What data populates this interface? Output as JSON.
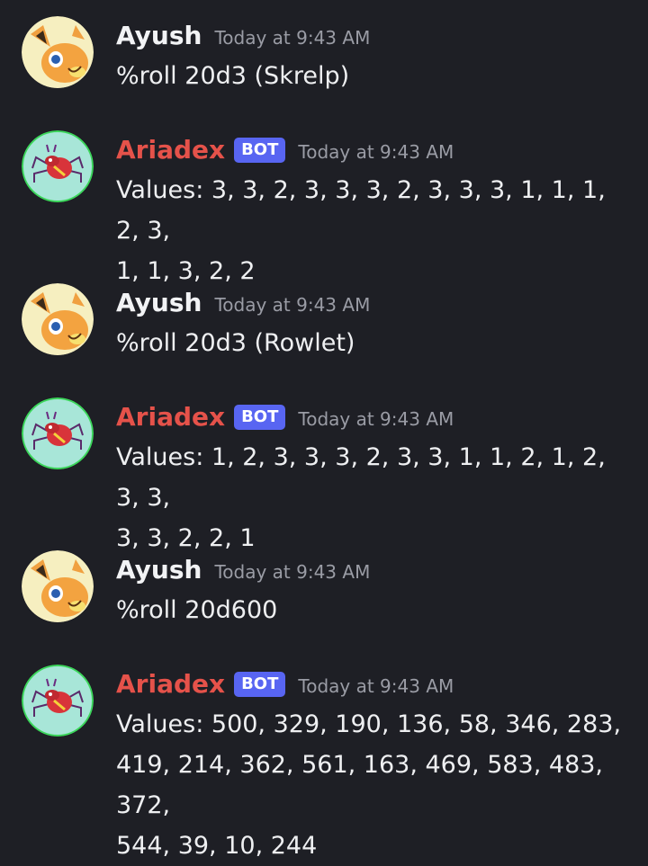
{
  "messages": [
    {
      "author": "Ayush",
      "is_bot": false,
      "timestamp": "Today at 9:43 AM",
      "lines": [
        "%roll 20d3 (Skrelp)"
      ]
    },
    {
      "author": "Ariadex",
      "is_bot": true,
      "bot_tag": "BOT",
      "timestamp": "Today at 9:43 AM",
      "lines": [
        "Values: 3, 3, 2, 3, 3, 3, 2, 3, 3, 3, 1, 1, 1, 2, 3,",
        "1, 1, 3, 2, 2"
      ]
    },
    {
      "author": "Ayush",
      "is_bot": false,
      "timestamp": "Today at 9:43 AM",
      "lines": [
        "%roll 20d3 (Rowlet)"
      ]
    },
    {
      "author": "Ariadex",
      "is_bot": true,
      "bot_tag": "BOT",
      "timestamp": "Today at 9:43 AM",
      "lines": [
        "Values: 1, 2, 3, 3, 3, 2, 3, 3, 1, 1, 2, 1, 2, 3, 3,",
        "3, 3, 2, 2, 1"
      ]
    },
    {
      "author": "Ayush",
      "is_bot": false,
      "timestamp": "Today at 9:43 AM",
      "lines": [
        "%roll 20d600"
      ]
    },
    {
      "author": "Ariadex",
      "is_bot": true,
      "bot_tag": "BOT",
      "timestamp": "Today at 9:43 AM",
      "lines": [
        "Values: 500, 329, 190, 136, 58, 346, 283,",
        "419, 214, 362, 561, 163, 469, 583, 483, 372,",
        "544, 39, 10, 244"
      ]
    }
  ],
  "avatars": {
    "user": {
      "icon": "raichu-avatar-icon",
      "bg": "#f6efc0"
    },
    "bot": {
      "icon": "ariados-avatar-icon",
      "bg": "#a8e6d8",
      "ring": "#3bd65a"
    }
  },
  "colors": {
    "background": "#1e1f25",
    "bot_name": "#e5524a",
    "bot_tag_bg": "#5865f2",
    "timestamp": "#9a9ca5"
  }
}
